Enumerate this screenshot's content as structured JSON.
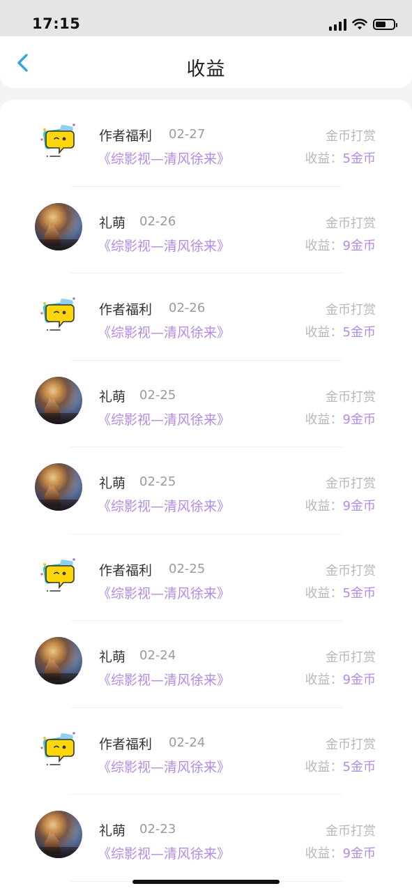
{
  "status_bar": {
    "time": "17:15",
    "battery_level": 0.6
  },
  "nav": {
    "title": "收益",
    "back_icon": "chevron-left-icon",
    "accent_color": "#2aa7e6"
  },
  "colors": {
    "link": "#b48ae6",
    "muted": "#b8b8b8",
    "text": "#333333"
  },
  "items": [
    {
      "kind": "logo",
      "name": "作者福利",
      "date": "02-27",
      "book": "《综影视—清风徐来》",
      "type": "金币打赏",
      "income_label": "收益：",
      "amount": "5金币"
    },
    {
      "kind": "photo",
      "name": "礼萌",
      "date": "02-26",
      "book": "《综影视—清风徐来》",
      "type": "金币打赏",
      "income_label": "收益：",
      "amount": "9金币"
    },
    {
      "kind": "logo",
      "name": "作者福利",
      "date": "02-26",
      "book": "《综影视—清风徐来》",
      "type": "金币打赏",
      "income_label": "收益：",
      "amount": "5金币"
    },
    {
      "kind": "photo",
      "name": "礼萌",
      "date": "02-25",
      "book": "《综影视—清风徐来》",
      "type": "金币打赏",
      "income_label": "收益：",
      "amount": "9金币"
    },
    {
      "kind": "photo",
      "name": "礼萌",
      "date": "02-25",
      "book": "《综影视—清风徐来》",
      "type": "金币打赏",
      "income_label": "收益：",
      "amount": "9金币"
    },
    {
      "kind": "logo",
      "name": "作者福利",
      "date": "02-25",
      "book": "《综影视—清风徐来》",
      "type": "金币打赏",
      "income_label": "收益：",
      "amount": "5金币"
    },
    {
      "kind": "photo",
      "name": "礼萌",
      "date": "02-24",
      "book": "《综影视—清风徐来》",
      "type": "金币打赏",
      "income_label": "收益：",
      "amount": "9金币"
    },
    {
      "kind": "logo",
      "name": "作者福利",
      "date": "02-24",
      "book": "《综影视—清风徐来》",
      "type": "金币打赏",
      "income_label": "收益：",
      "amount": "5金币"
    },
    {
      "kind": "photo",
      "name": "礼萌",
      "date": "02-23",
      "book": "《综影视—清风徐来》",
      "type": "金币打赏",
      "income_label": "收益：",
      "amount": "9金币"
    }
  ]
}
